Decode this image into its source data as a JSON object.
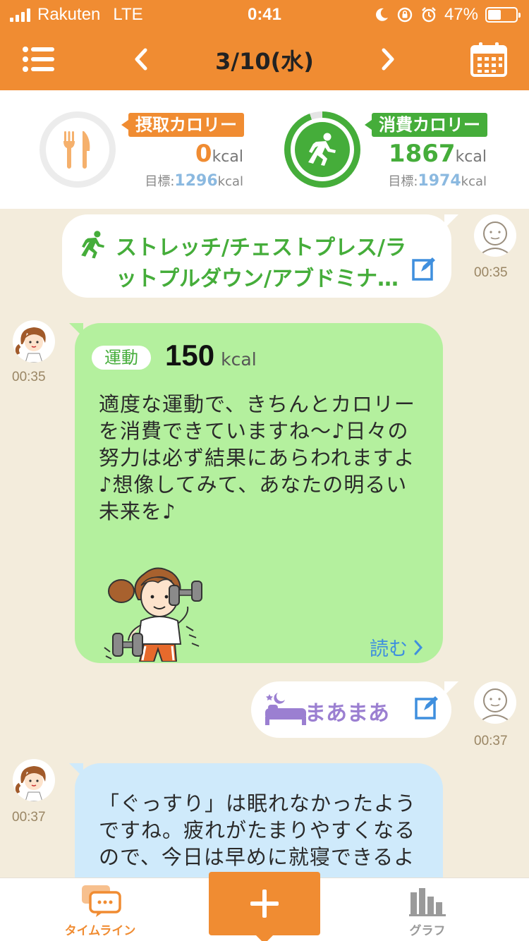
{
  "status_bar": {
    "carrier": "Rakuten",
    "network": "LTE",
    "time": "0:41",
    "battery": "47%",
    "battery_level": 0.47
  },
  "nav": {
    "date": "3/10(水)",
    "prev_icon": "chevron-left-icon",
    "next_icon": "chevron-right-icon",
    "menu_icon": "menu-icon",
    "calendar_icon": "calendar-icon"
  },
  "summary": {
    "intake": {
      "label": "摂取カロリー",
      "value": "0",
      "unit": "kcal",
      "goal_prefix": "目標:",
      "goal_value": "1296",
      "goal_unit": "kcal",
      "icon": "fork-knife-icon",
      "progress": 0,
      "color": "#f08c32"
    },
    "burned": {
      "label": "消費カロリー",
      "value": "1867",
      "unit": "kcal",
      "goal_prefix": "目標:",
      "goal_value": "1974",
      "goal_unit": "kcal",
      "icon": "running-icon",
      "progress": 0.946,
      "color": "#45ad3a"
    }
  },
  "timeline": {
    "exercise_entry": {
      "line1": "ストレッチ/チェストプレス/ラ",
      "line2": "ットプルダウン/アブドミナ…",
      "time": "00:35",
      "icon": "running-icon"
    },
    "exercise_reply": {
      "tag": "運動",
      "value": "150",
      "unit": "kcal",
      "lines": [
        "適度な運動で、きちんとカロリー",
        "を消費できていますね〜♪日々の",
        "努力は必ず結果にあらわれますよ",
        "♪想像してみて、あなたの明るい",
        "未来を♪"
      ],
      "read_more": "読む",
      "time": "00:35"
    },
    "sleep_entry": {
      "label": "まあまあ",
      "time": "00:37",
      "icon": "bed-moon-icon"
    },
    "sleep_reply": {
      "lines": [
        "「ぐっすり」は眠れなかったよう",
        "ですね。疲れがたまりやすくなる",
        "ので、今日は早めに就寝できるよ"
      ],
      "time": "00:37"
    }
  },
  "tabbar": {
    "timeline_label": "タイムライン",
    "graph_label": "グラフ",
    "active_color": "#f08c32",
    "inactive_color": "#9a9a9a"
  }
}
